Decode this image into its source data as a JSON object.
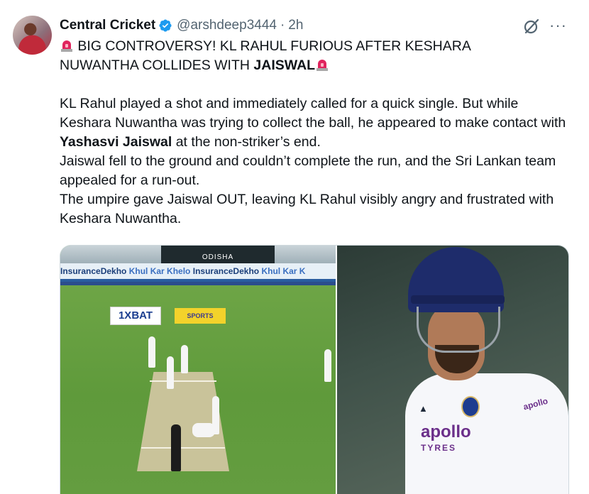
{
  "tweet": {
    "author_name": "Central Cricket",
    "handle": "@arshdeep3444",
    "separator": "·",
    "time": "2h",
    "more_label": "···",
    "headline_part1": "BIG CONTROVERSY! KL RAHUL FURIOUS AFTER KESHARA",
    "headline_part2": "NUWANTHA COLLIDES WITH ",
    "headline_bold": "JAISWAL",
    "body": {
      "p1_part1": "KL Rahul played a shot and immediately called for a quick single. But while Keshara Nuwantha was trying to collect the ball, he appeared to make contact with ",
      "p1_bold": "Yashasvi Jaiswal",
      "p1_part2": " at the non-striker’s end.",
      "p2": "Jaiswal fell to the ground and couldn’t complete the run, and the Sri Lankan team appealed for a run-out.",
      "p3": "The umpire gave Jaiswal OUT, leaving KL Rahul visibly angry and frustrated with Keshara Nuwantha."
    }
  },
  "media": {
    "left": {
      "board_text": "ODISHA",
      "ad_text_1": "InsuranceDekho",
      "ad_text_2": "Khul Kar Khelo",
      "ad_text_3": "InsuranceDekho",
      "ad_text_4": "Khul Kar K",
      "logo_1": "1XBAT",
      "logo_2": "SPORTS"
    },
    "right": {
      "sponsor_main": "apollo",
      "sponsor_sub": "TYRES",
      "sleeve_text": "apollo"
    }
  },
  "colors": {
    "verified": "#1d9bf0",
    "secondary_text": "#536471",
    "siren": "#e0245e"
  },
  "icons": {
    "verified": "verified-badge-icon",
    "grok": "grok-icon",
    "siren": "police-light-emoji"
  }
}
